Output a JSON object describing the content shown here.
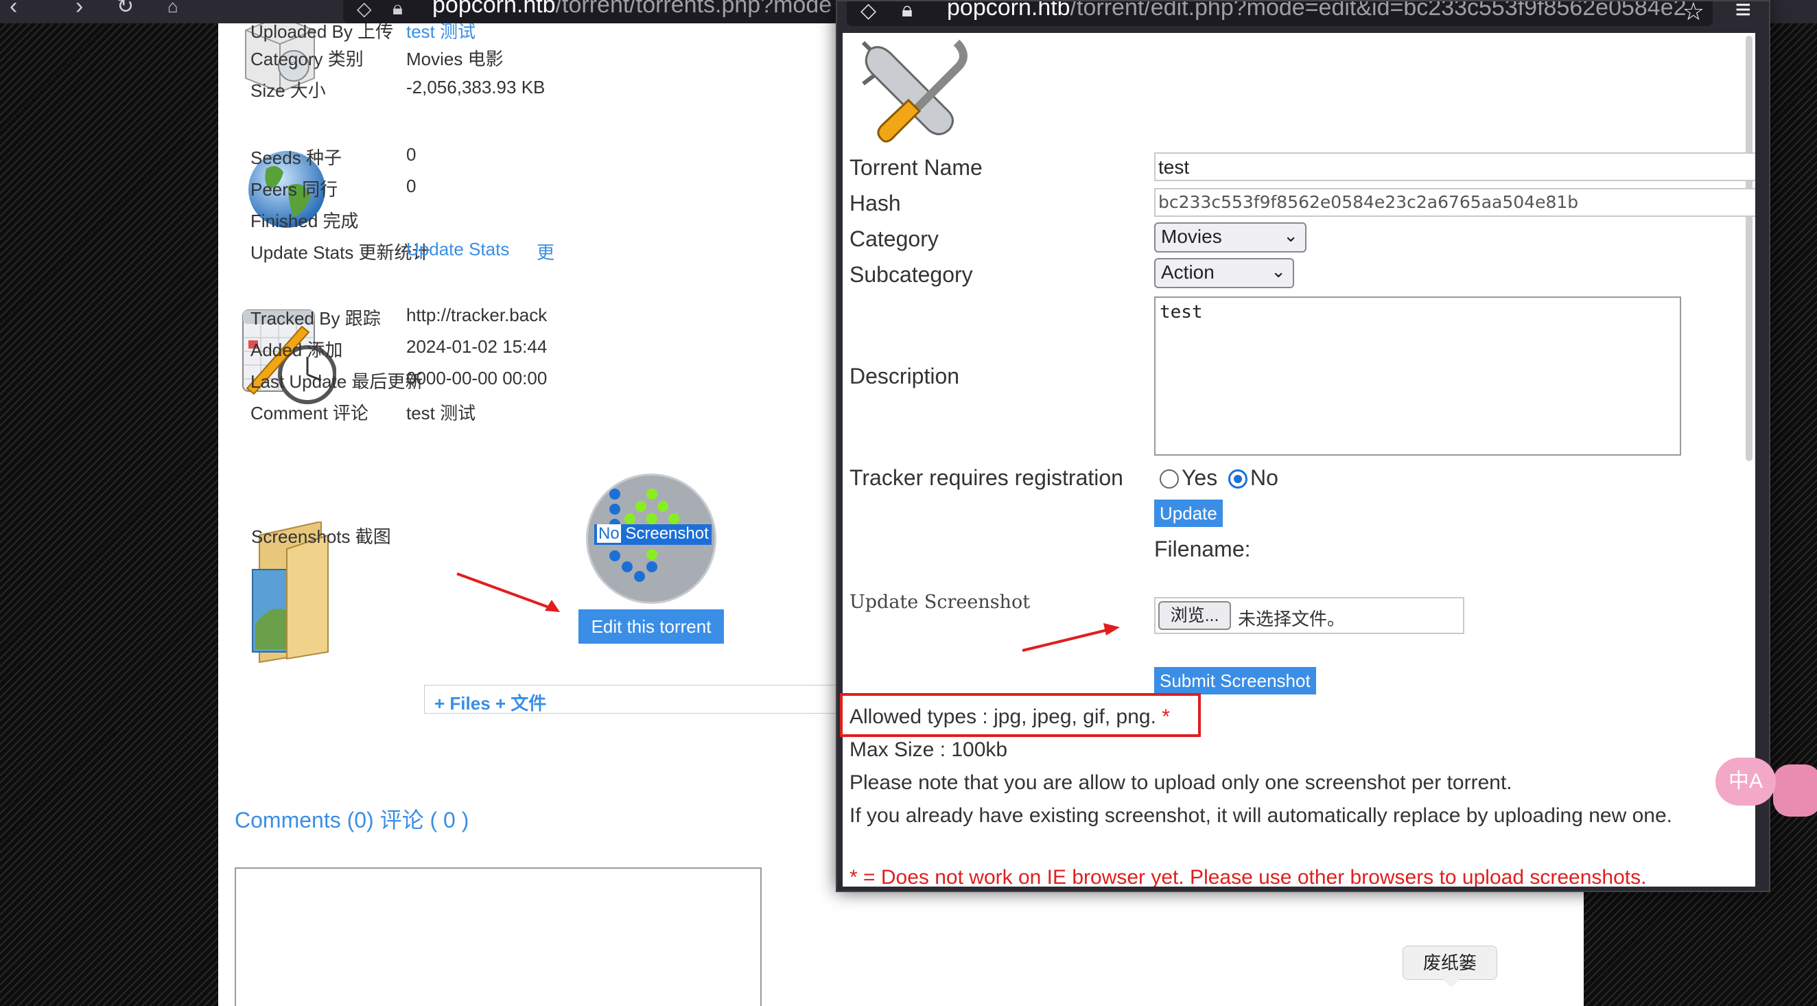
{
  "background_browser": {
    "url_host": "popcorn.htb",
    "url_path": "/torrent/torrents.php?mode"
  },
  "torrent_info": {
    "uploaded_by_label": "Uploaded By 上传",
    "uploaded_by_value": "test 测试",
    "category_label": "Category 类别",
    "category_value": "Movies 电影",
    "size_label": "Size 大小",
    "size_value": "-2,056,383.93 KB",
    "seeds_label": "Seeds 种子",
    "seeds_value": "0",
    "peers_label": "Peers 同行",
    "peers_value": "0",
    "finished_label": "Finished 完成",
    "update_stats_label": "Update Stats 更新统计",
    "update_stats_link": "Update Stats",
    "update_stats_link_cn": "更",
    "tracked_by_label": "Tracked By 跟踪",
    "tracked_by_value": "http://tracker.back",
    "added_label": "Added 添加",
    "added_value": "2024-01-02 15:44",
    "last_update_label": "Last Update 最后更新",
    "last_update_value": "0000-00-00 00:00",
    "comment_label": "Comment 评论",
    "comment_value": "test 测试",
    "screenshots_label": "Screenshots 截图",
    "no_screenshot_no": "No",
    "no_screenshot_text": "Screenshot",
    "edit_button": "Edit this torrent",
    "files_bar": "+ Files + 文件",
    "comments_title": "Comments (0) 评论 ( 0 )"
  },
  "popup": {
    "url_host": "popcorn.htb",
    "url_path": "/torrent/edit.php?mode=edit&id=bc233c553f9f8562e0584e2",
    "form": {
      "torrent_name_label": "Torrent Name",
      "torrent_name_value": "test",
      "hash_label": "Hash",
      "hash_value": "bc233c553f9f8562e0584e23c2a6765aa504e81b",
      "category_label": "Category",
      "category_value": "Movies",
      "subcategory_label": "Subcategory",
      "subcategory_value": "Action",
      "description_label": "Description",
      "description_value": "test",
      "tracker_label": "Tracker requires registration",
      "tracker_yes": "Yes",
      "tracker_no": "No",
      "tracker_selected": "No",
      "update_button": "Update",
      "filename_label": "Filename:",
      "update_screenshot_label": "Update Screenshot",
      "browse_button": "浏览...",
      "file_status": "未选择文件。",
      "submit_screenshot_button": "Submit Screenshot",
      "allowed_types": "Allowed types : jpg, jpeg, gif, png.",
      "allowed_types_star": "*",
      "max_size": "Max Size : 100kb",
      "note_one": "Please note that you are allow to upload only one screenshot per torrent.",
      "note_replace": "If you already have existing screenshot, it will automatically replace by uploading new one.",
      "warning": "* = Does not work on IE browser yet. Please use other browsers to upload screenshots."
    }
  },
  "desktop": {
    "tooltip": "废纸篓",
    "translate_icon": "中A"
  },
  "colors": {
    "link_blue": "#3a8ee6",
    "annotation_red": "#e01e1e",
    "radio_blue": "#1c6fd6"
  }
}
